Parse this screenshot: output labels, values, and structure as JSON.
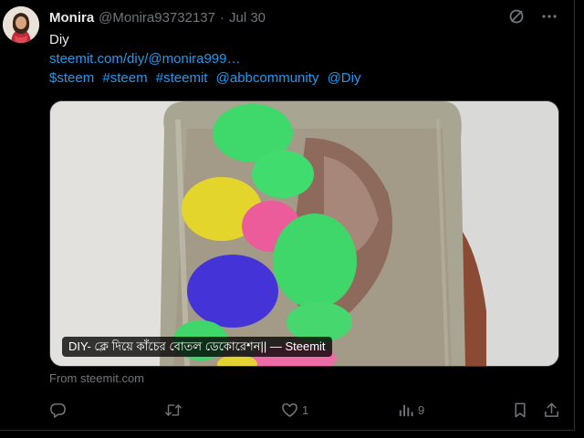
{
  "tweet": {
    "author_name": "Monira",
    "author_handle": "@Monira93732137",
    "separator": "·",
    "date": "Jul 30",
    "text_line1": "Diy",
    "link": "steemit.com/diy/@monira999…",
    "tags": [
      "$steem",
      "#steem",
      "#steemit",
      "@abbcommunity",
      "@Diy"
    ],
    "media_caption": "DIY- ক্লে দিয়ে কাঁচের বোতল ডেকোরেশন|| — Steemit",
    "source": "From steemit.com"
  },
  "actions": {
    "reply_count": "",
    "retweet_count": "",
    "like_count": "1",
    "views_count": "9"
  },
  "colors": {
    "background": "#000000",
    "text": "#e7e9ea",
    "muted": "#71767b",
    "link": "#1d9bf0"
  },
  "icons": [
    "grok-icon",
    "more-icon",
    "reply-icon",
    "retweet-icon",
    "like-icon",
    "views-icon",
    "bookmark-icon",
    "share-icon"
  ]
}
